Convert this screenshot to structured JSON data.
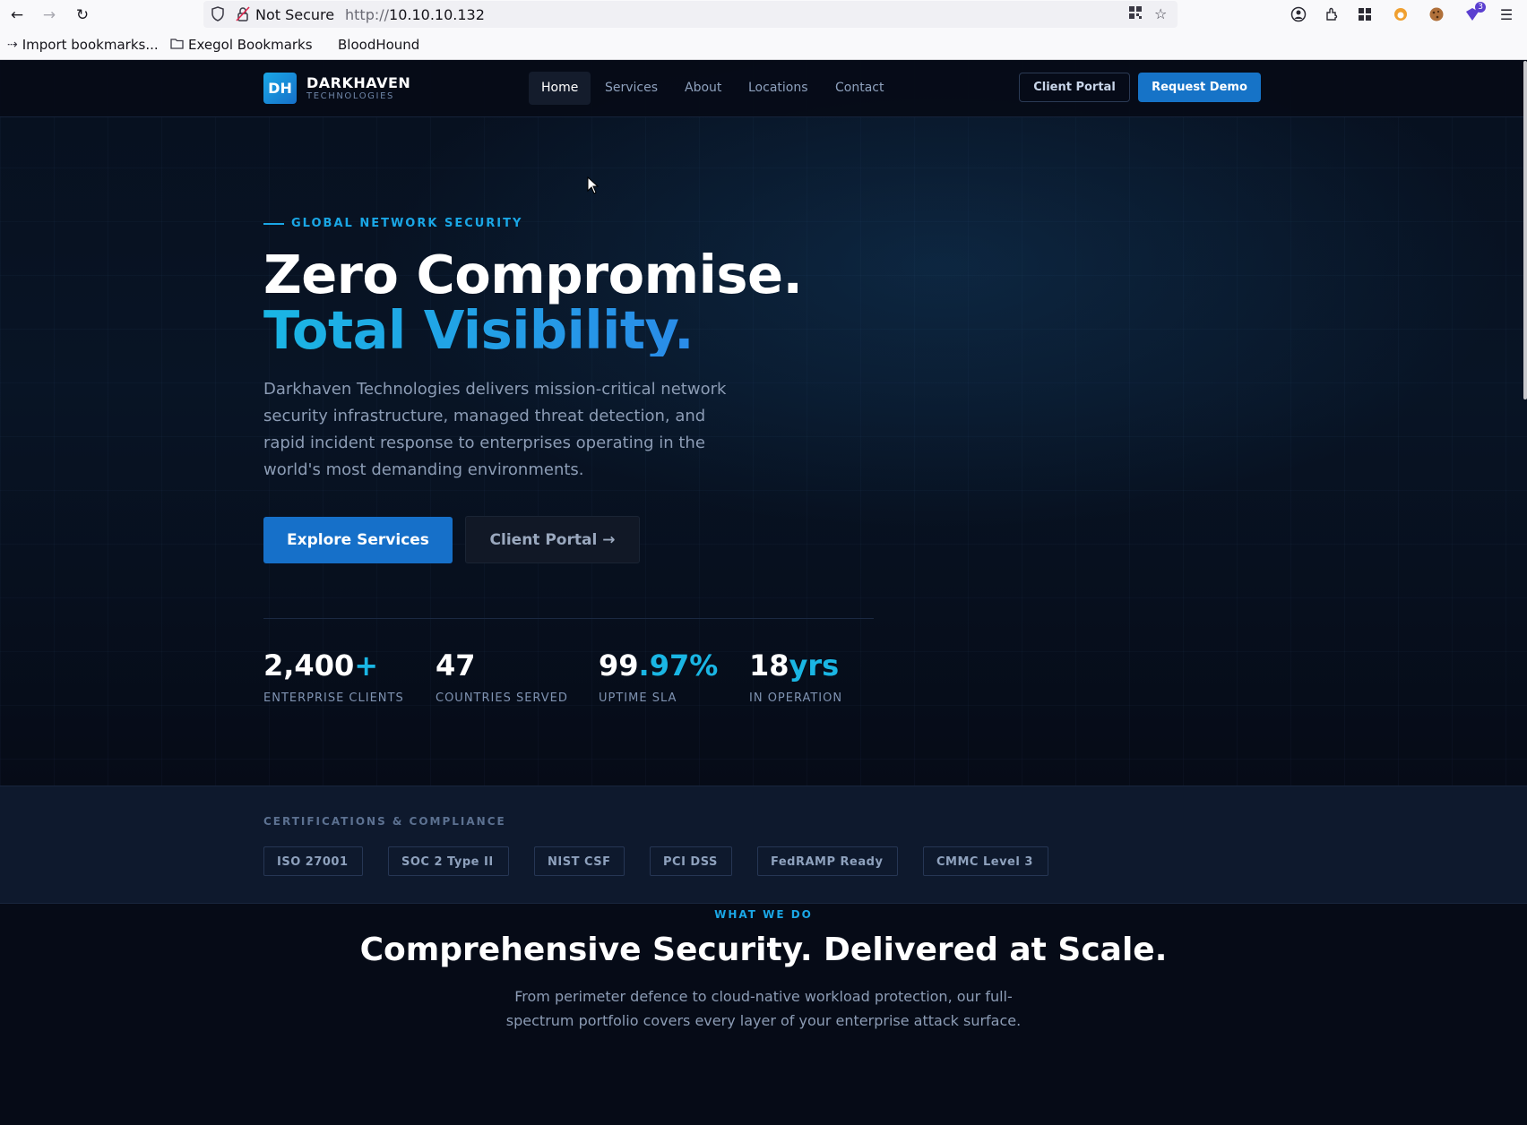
{
  "browser": {
    "not_secure_label": "Not Secure",
    "url_scheme": "http://",
    "url_host": "10.10.10.132",
    "extension_badge": "3",
    "bookmarks": [
      {
        "label": "Import bookmarks...",
        "icon": "import-icon"
      },
      {
        "label": "Exegol Bookmarks",
        "icon": "folder-icon"
      },
      {
        "label": "BloodHound",
        "icon": ""
      }
    ]
  },
  "header": {
    "logo_mark": "DH",
    "logo_name": "DARKHAVEN",
    "logo_sub": "TECHNOLOGIES",
    "nav": [
      {
        "label": "Home",
        "active": true
      },
      {
        "label": "Services",
        "active": false
      },
      {
        "label": "About",
        "active": false
      },
      {
        "label": "Locations",
        "active": false
      },
      {
        "label": "Contact",
        "active": false
      }
    ],
    "client_portal": "Client Portal",
    "request_demo": "Request Demo"
  },
  "hero": {
    "eyebrow": "GLOBAL NETWORK SECURITY",
    "title_line1": "Zero Compromise.",
    "title_line2": "Total Visibility.",
    "description": "Darkhaven Technologies delivers mission-critical network security infrastructure, managed threat detection, and rapid incident response to enterprises operating in the world's most demanding environments.",
    "cta_primary": "Explore Services",
    "cta_secondary": "Client Portal →",
    "stats": [
      {
        "value": "2,400",
        "accent": "+",
        "label": "ENTERPRISE CLIENTS"
      },
      {
        "value": "47",
        "accent": "",
        "label": "COUNTRIES SERVED"
      },
      {
        "value": "99",
        "accent": ".97%",
        "label": "UPTIME SLA"
      },
      {
        "value": "18",
        "accent": "yrs",
        "label": "IN OPERATION"
      }
    ]
  },
  "certifications": {
    "title": "CERTIFICATIONS & COMPLIANCE",
    "items": [
      "ISO 27001",
      "SOC 2 Type II",
      "NIST CSF",
      "PCI DSS",
      "FedRAMP Ready",
      "CMMC Level 3"
    ]
  },
  "what_we_do": {
    "eyebrow": "WHAT WE DO",
    "title": "Comprehensive Security. Delivered at Scale.",
    "description": "From perimeter defence to cloud-native workload protection, our full-spectrum portfolio covers every layer of your enterprise attack surface."
  },
  "colors": {
    "accent": "#1ab6e4",
    "brand_blue": "#1670c9",
    "background": "#060b17"
  }
}
